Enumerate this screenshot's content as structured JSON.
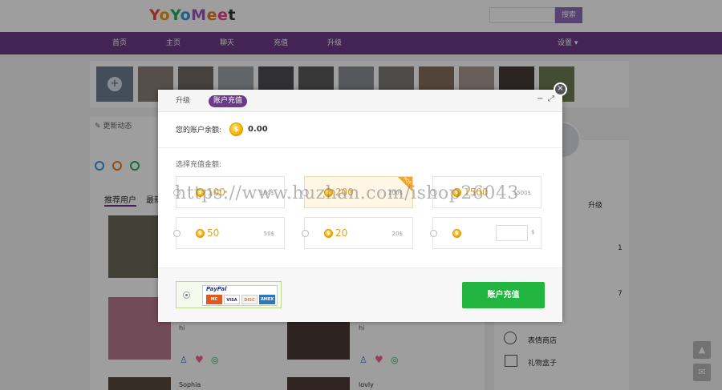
{
  "site": {
    "logo": [
      "Y",
      "o",
      "Y",
      "o",
      "M",
      "e",
      "e",
      "t"
    ],
    "search_button": "搜索",
    "nav": [
      "首页",
      "主页",
      "聊天",
      "充值",
      "升级"
    ],
    "nav_settings": "设置 ▾"
  },
  "feed": {
    "status_label": "更新动态",
    "tabs": [
      "推荐用户",
      "最新"
    ],
    "users": [
      {
        "text": "hi"
      },
      {
        "text": "hi"
      },
      {
        "name": "Sophia"
      },
      {
        "name": "lovly"
      }
    ]
  },
  "sidebar": {
    "upgrade": "升级",
    "count_1": "1",
    "count_2": "7",
    "sticker_store": "表情商店",
    "gift_box": "礼物盒子"
  },
  "modal": {
    "tab_upgrade": "升级",
    "tab_recharge": "账户充值",
    "balance_label": "您的账户余额:",
    "balance_value": "0.00",
    "choose_label": "选择充值金额:",
    "options": [
      {
        "amount": "100",
        "price": "100$"
      },
      {
        "amount": "200",
        "price": "200$",
        "badge": "HOT"
      },
      {
        "amount": "1500",
        "price": "1500$"
      },
      {
        "amount": "50",
        "price": "50$"
      },
      {
        "amount": "20",
        "price": "20$"
      },
      {
        "amount": "",
        "price": "$"
      }
    ],
    "paypal_label": "PayPal",
    "cards": [
      "MC",
      "VISA",
      "DISC",
      "AMEX"
    ],
    "recharge_button": "账户充值"
  },
  "watermark": "https://www.huzhan.com/ishop26043",
  "colors": {
    "nav_purple": "#6d3a8a",
    "recharge_green": "#22b540",
    "coin_gold": "#f5b400"
  }
}
